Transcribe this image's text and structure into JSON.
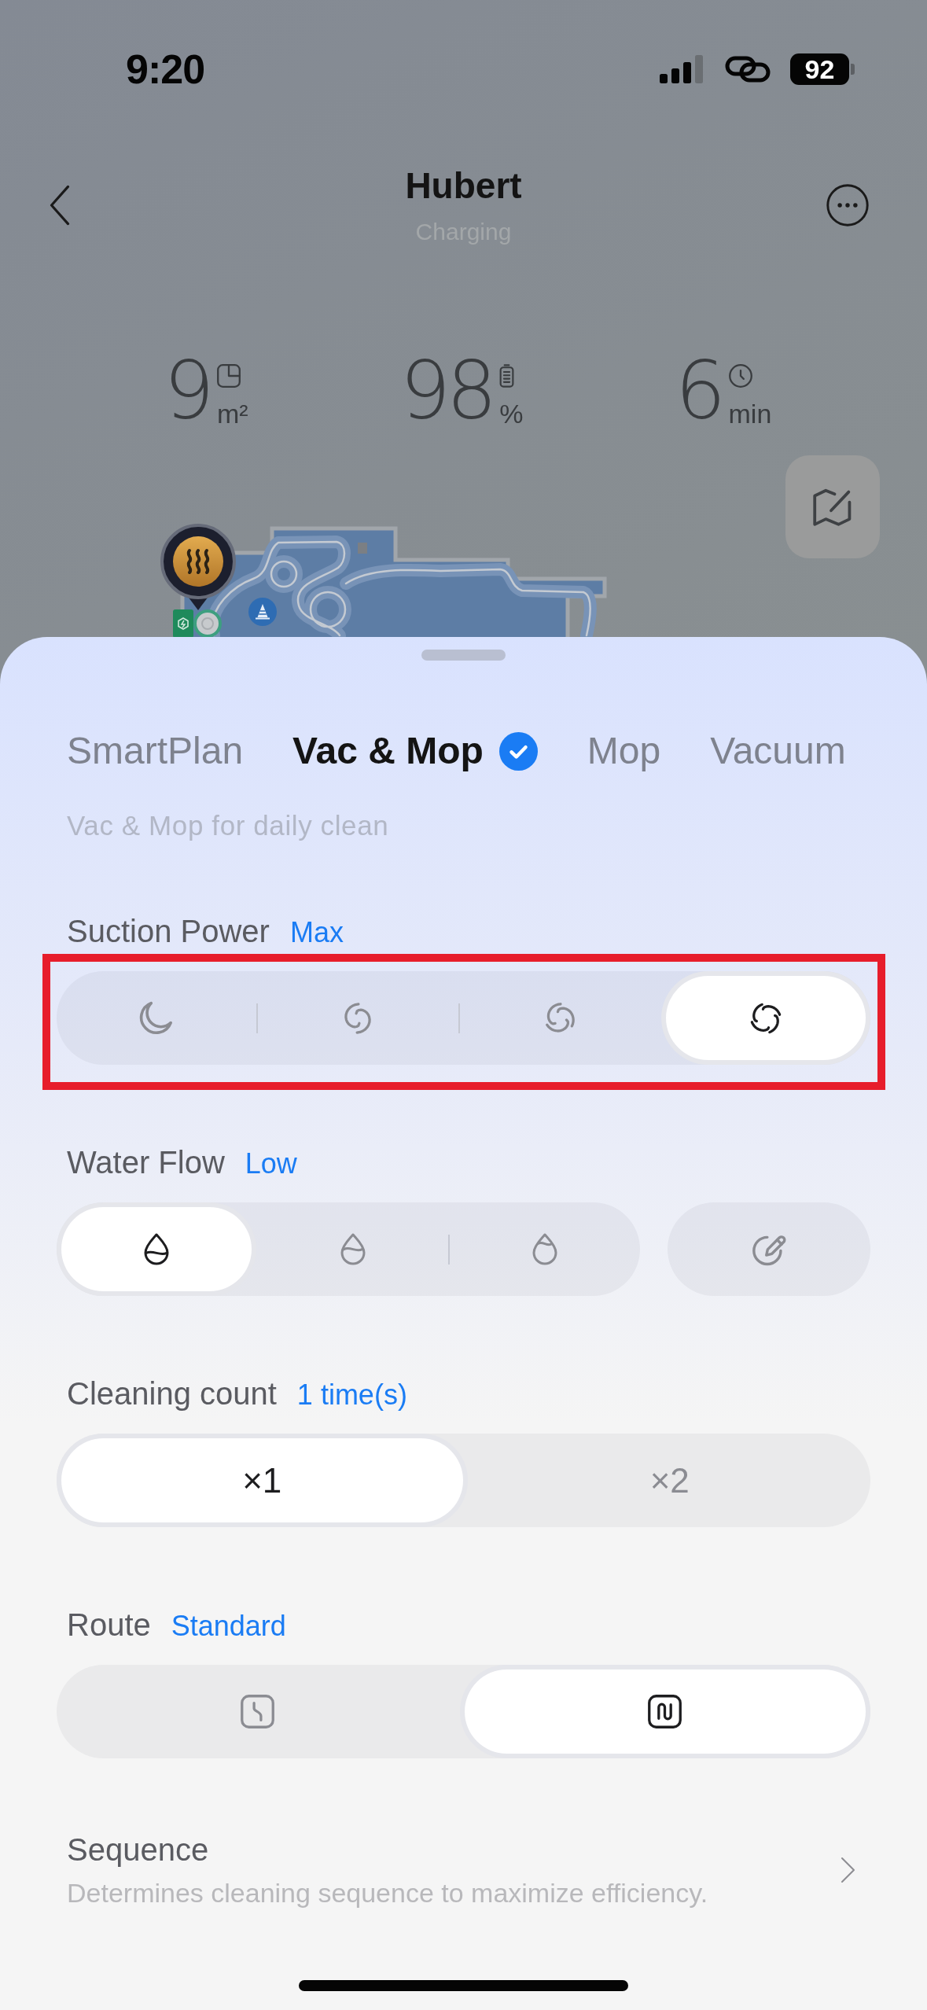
{
  "status_bar": {
    "time": "9:20",
    "battery": "92"
  },
  "header": {
    "title": "Hubert",
    "status": "Charging"
  },
  "stats": [
    {
      "kind": "area",
      "value": "9",
      "unit": "m²"
    },
    {
      "kind": "battery",
      "value": "98",
      "unit": "%"
    },
    {
      "kind": "duration",
      "value": "6",
      "unit": "min"
    }
  ],
  "mode_tabs": [
    {
      "label": "SmartPlan",
      "selected": false
    },
    {
      "label": "Vac & Mop",
      "selected": true
    },
    {
      "label": "Mop",
      "selected": false
    },
    {
      "label": "Vacuum",
      "selected": false
    }
  ],
  "mode_description": "Vac & Mop for daily clean",
  "settings": [
    {
      "label": "Suction Power",
      "value": "Max",
      "highlighted": true,
      "options": [
        {
          "kind": "moon",
          "selected": false
        },
        {
          "kind": "swirl2",
          "selected": false
        },
        {
          "kind": "swirl3",
          "selected": false
        },
        {
          "kind": "swirl4",
          "selected": true
        }
      ]
    },
    {
      "label": "Water Flow",
      "value": "Low",
      "highlighted": false,
      "options": [
        {
          "kind": "drop1",
          "selected": true
        },
        {
          "kind": "drop2",
          "selected": false
        },
        {
          "kind": "drop3",
          "selected": false
        }
      ],
      "custom_button": {
        "kind": "pencil",
        "selected": false
      }
    },
    {
      "label": "Cleaning count",
      "value": "1 time(s)",
      "highlighted": false,
      "options": [
        {
          "kind": "text",
          "text": "×1",
          "selected": true
        },
        {
          "kind": "text",
          "text": "×2",
          "selected": false
        }
      ]
    },
    {
      "label": "Route",
      "value": "Standard",
      "highlighted": false,
      "options": [
        {
          "kind": "curve",
          "selected": false
        },
        {
          "kind": "serpentine",
          "selected": true
        }
      ]
    }
  ],
  "sequence": {
    "title": "Sequence",
    "description": "Determines cleaning sequence to maximize efficiency."
  }
}
